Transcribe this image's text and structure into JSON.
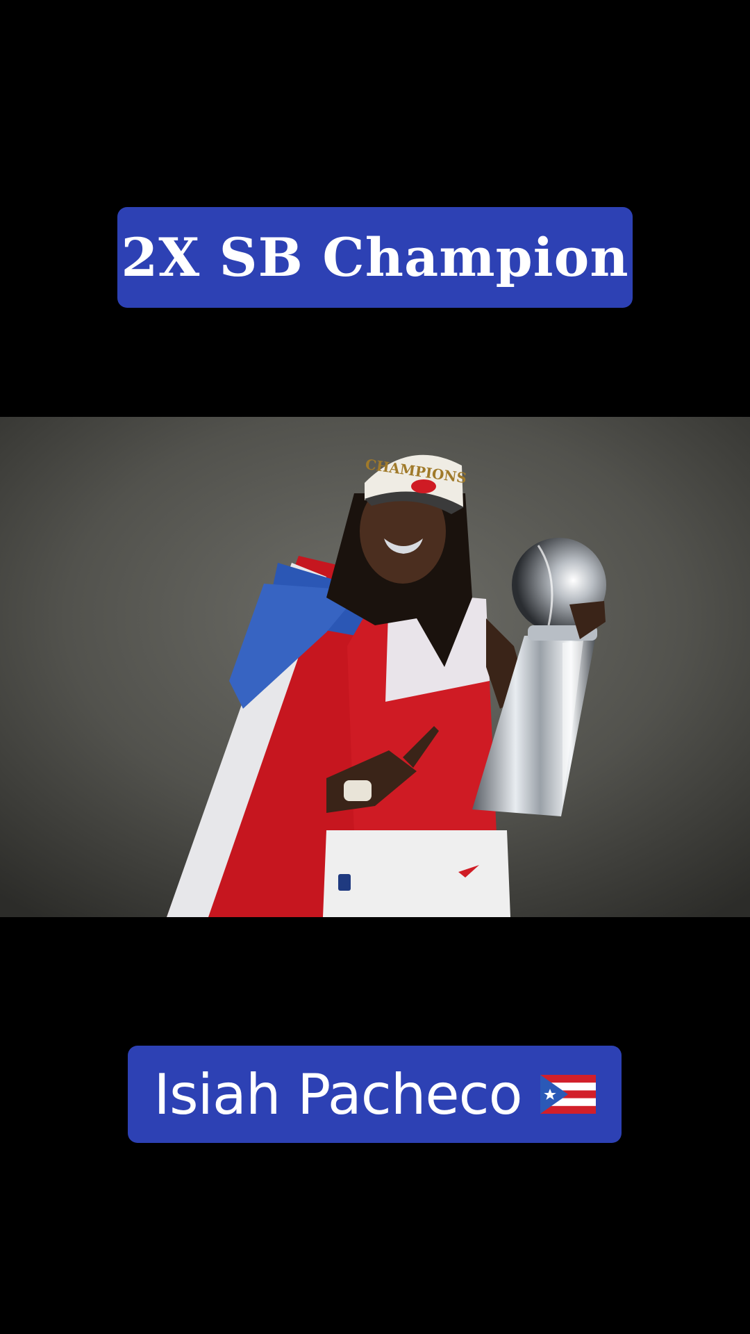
{
  "top_banner": {
    "text": "2X SB Champion",
    "color": "#2d41b4"
  },
  "photo": {
    "hat_text": "CHAMPIONS",
    "subject_icon": "football-player-with-trophy"
  },
  "bottom_banner": {
    "name": "Isiah Pacheco",
    "flag_icon": "puerto-rico-flag-icon",
    "color": "#2d41b4"
  }
}
